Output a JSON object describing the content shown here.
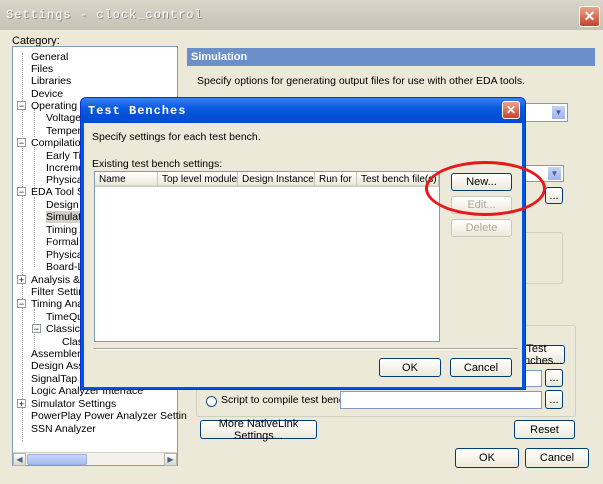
{
  "window": {
    "title": "Settings - clock_control",
    "close": "✕"
  },
  "category_label": "Category:",
  "tree": {
    "items": [
      {
        "label": "General"
      },
      {
        "label": "Files"
      },
      {
        "label": "Libraries"
      },
      {
        "label": "Device"
      },
      {
        "label": "Operating Se"
      },
      {
        "label": "Voltage"
      },
      {
        "label": "Tempera"
      },
      {
        "label": "Compilation P"
      },
      {
        "label": "Early Tin"
      },
      {
        "label": "Increme"
      },
      {
        "label": "Physical"
      },
      {
        "label": "EDA Tool Se"
      },
      {
        "label": "Design E"
      },
      {
        "label": "Simulatio"
      },
      {
        "label": "Timing A"
      },
      {
        "label": "Formal V"
      },
      {
        "label": "Physical"
      },
      {
        "label": "Board-Le"
      },
      {
        "label": "Analysis & Sy"
      },
      {
        "label": "Filter Setting"
      },
      {
        "label": "Timing Analy"
      },
      {
        "label": "TimeQue"
      },
      {
        "label": "Classic T"
      },
      {
        "label": "Clas"
      },
      {
        "label": "Assembler"
      },
      {
        "label": "Design Assis"
      },
      {
        "label": "SignalTap II"
      },
      {
        "label": "Logic Analyzer Interface"
      },
      {
        "label": "Simulator Settings"
      },
      {
        "label": "PowerPlay Power Analyzer Settings"
      },
      {
        "label": "SSN Analyzer"
      }
    ],
    "expanders": [
      "−",
      "−",
      "−",
      "+",
      "−",
      "−",
      "+"
    ]
  },
  "simulation": {
    "header": "Simulation",
    "description": "Specify options for generating output files for use with other EDA tools.",
    "test_benches_button": "Test Benches...",
    "ellipsis": "...",
    "script_radio_label": "Script to compile test bench:",
    "nativelink_button": "More NativeLink Settings...",
    "reset_button": "Reset"
  },
  "footer": {
    "ok": "OK",
    "cancel": "Cancel"
  },
  "dialog": {
    "title": "Test Benches",
    "close": "✕",
    "description": "Specify settings for each test bench.",
    "list_label": "Existing test bench settings:",
    "columns": [
      "Name",
      "Top level module",
      "Design Instance",
      "Run for",
      "Test bench file(s)"
    ],
    "new_button": "New...",
    "edit_button": "Edit...",
    "delete_button": "Delete",
    "ok_button": "OK",
    "cancel_button": "Cancel"
  },
  "annotation_color": "#e8181b"
}
